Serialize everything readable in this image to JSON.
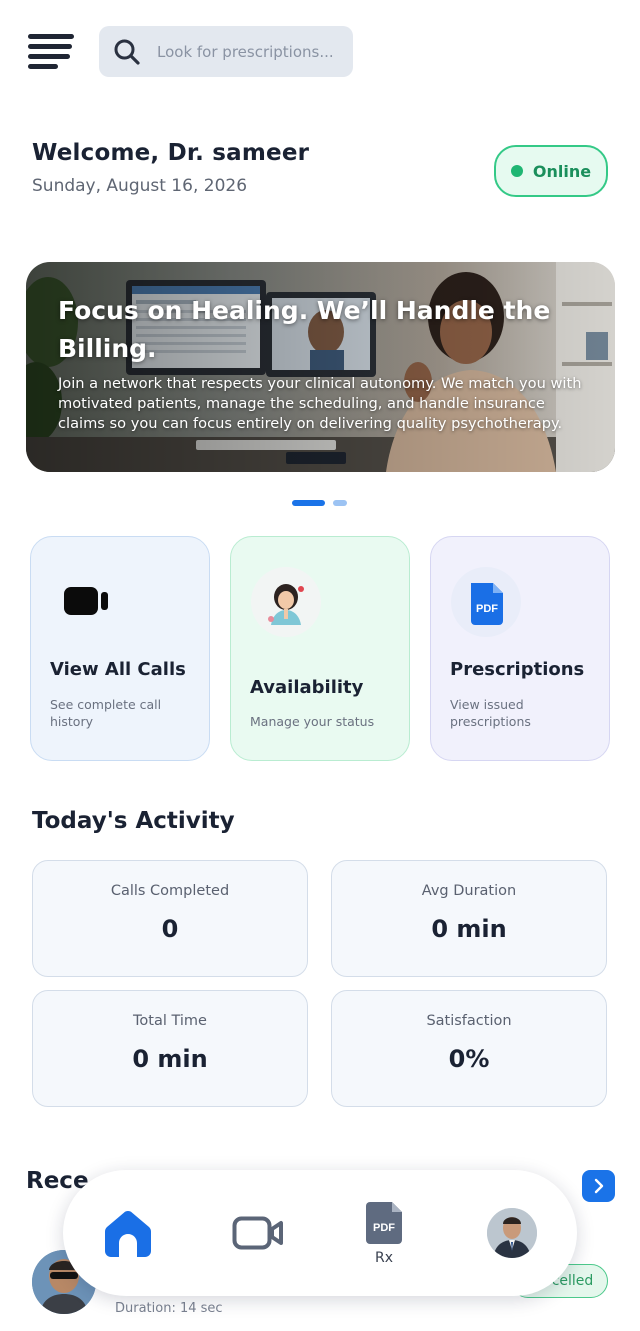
{
  "header": {
    "search_placeholder": "Look for prescriptions..."
  },
  "welcome": {
    "title": "Welcome, Dr. sameer",
    "date": "Sunday, August 16, 2026",
    "status": "Online"
  },
  "banner": {
    "title": "Focus on Healing. We’ll Handle the Billing.",
    "text": "Join a network that respects your clinical autonomy. We match you with motivated patients, manage the scheduling, and handle insurance claims so you can focus entirely on delivering quality psychotherapy.",
    "slides": 2,
    "active_slide": 1
  },
  "cards": [
    {
      "title": "View All Calls",
      "subtitle": "See complete call history",
      "icon": "video-camera-icon"
    },
    {
      "title": "Availability",
      "subtitle": "Manage your status",
      "icon": "doctor-avatar-icon"
    },
    {
      "title": "Prescriptions",
      "subtitle": "View issued prescriptions",
      "icon": "pdf-file-icon"
    }
  ],
  "activity": {
    "title": "Today's Activity",
    "stats": [
      {
        "label": "Calls Completed",
        "value": "0"
      },
      {
        "label": "Avg Duration",
        "value": "0 min"
      },
      {
        "label": "Total Time",
        "value": "0 min"
      },
      {
        "label": "Satisfaction",
        "value": "0%"
      }
    ]
  },
  "recent": {
    "title": "Rece",
    "duration": "Duration: 14 sec",
    "status": "celled"
  },
  "nav": {
    "rx_label": "Rx",
    "pdf_text": "PDF"
  },
  "colors": {
    "accent": "#1a73e8",
    "online": "#1fb673"
  }
}
